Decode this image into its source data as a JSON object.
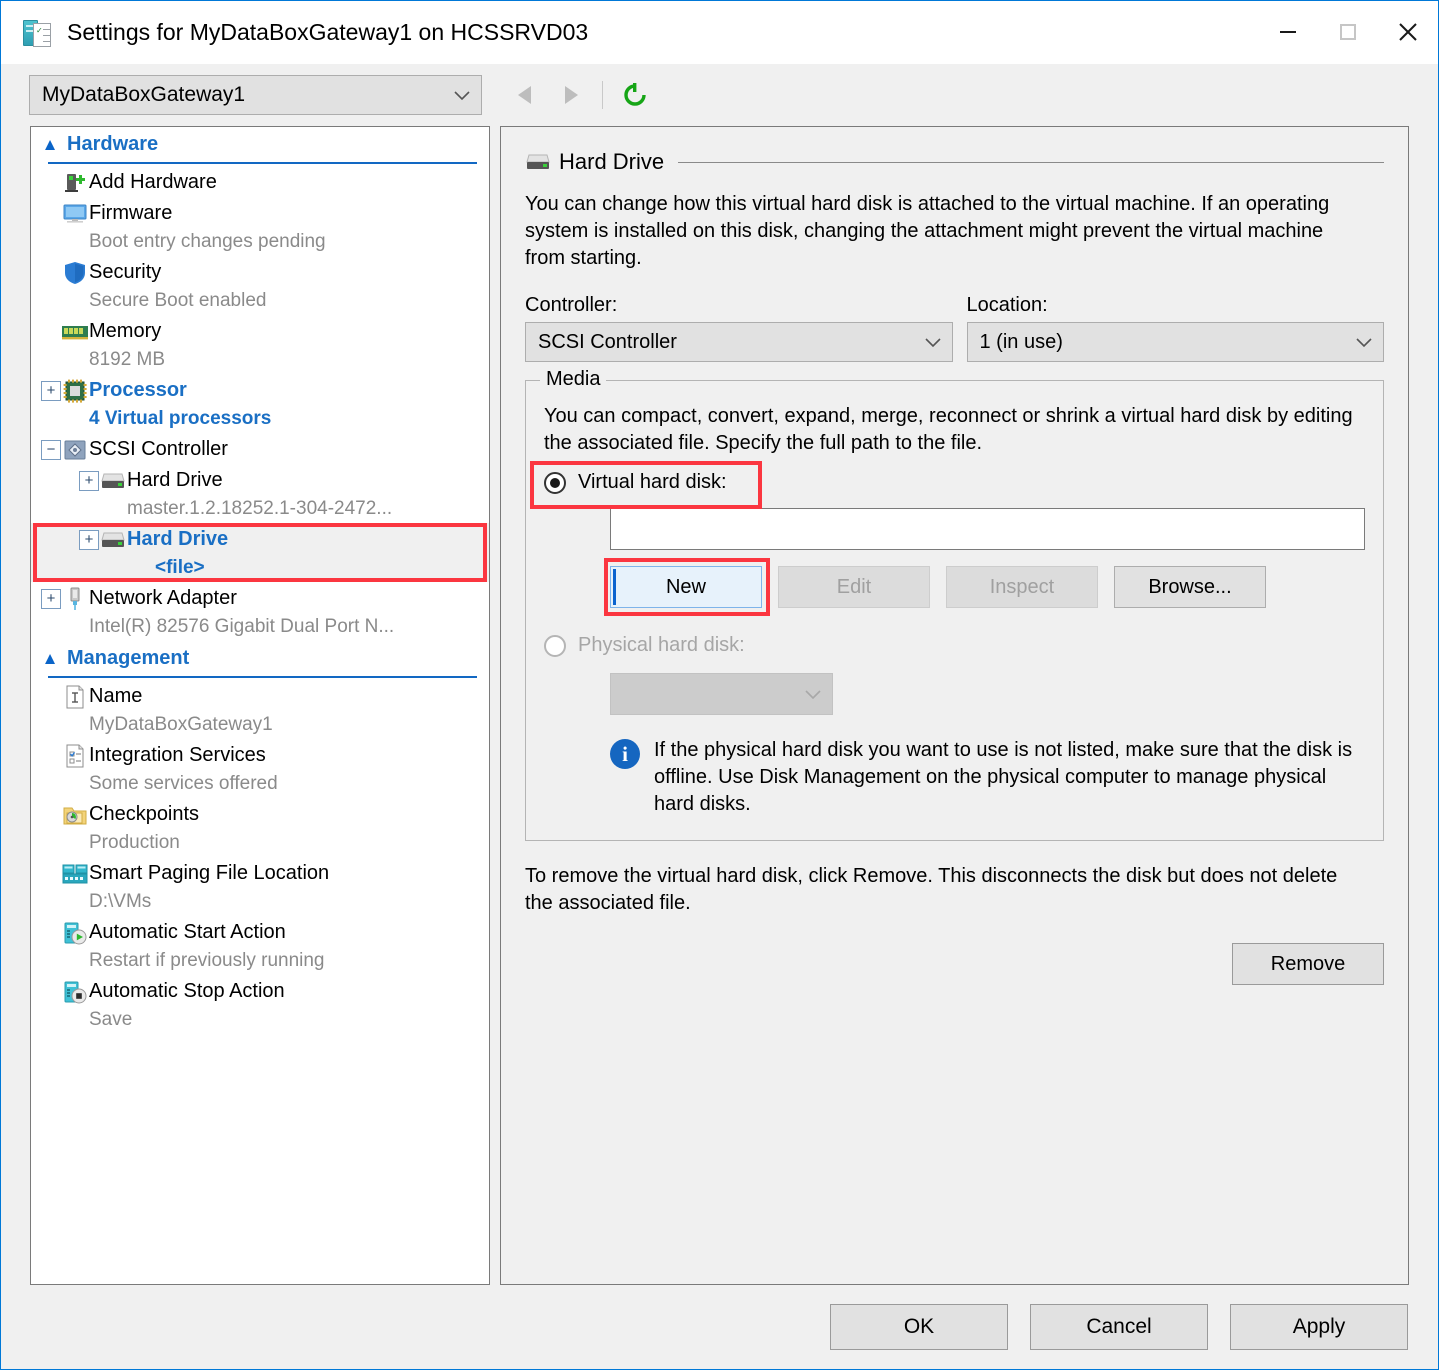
{
  "window": {
    "title": "Settings for MyDataBoxGateway1 on HCSSRVD03",
    "title_icon": "settings-document-icon",
    "minimize_label": "Minimize",
    "maximize_label": "Maximize",
    "close_label": "Close"
  },
  "toolbar": {
    "vm_selector_value": "MyDataBoxGateway1",
    "back_label": "Back",
    "forward_label": "Forward",
    "refresh_label": "Refresh"
  },
  "sidebar": {
    "sections": [
      {
        "id": "hardware",
        "label": "Hardware",
        "items": [
          {
            "icon": "add-hardware-icon",
            "title": "Add Hardware",
            "sub": "",
            "expander": "",
            "highlighted": false,
            "selected": false
          },
          {
            "icon": "firmware-monitor-icon",
            "title": "Firmware",
            "sub": "Boot entry changes pending",
            "expander": "",
            "highlighted": false,
            "selected": false
          },
          {
            "icon": "security-shield-icon",
            "title": "Security",
            "sub": "Secure Boot enabled",
            "expander": "",
            "highlighted": false,
            "selected": false
          },
          {
            "icon": "memory-module-icon",
            "title": "Memory",
            "sub": "8192 MB",
            "expander": "",
            "highlighted": false,
            "selected": false
          },
          {
            "icon": "processor-chip-icon",
            "title": "Processor",
            "sub": "4 Virtual processors",
            "expander": "+",
            "highlighted": false,
            "selected": false,
            "blue": true
          },
          {
            "icon": "scsi-controller-icon",
            "title": "SCSI Controller",
            "sub": "",
            "expander": "−",
            "highlighted": false,
            "selected": false
          },
          {
            "icon": "hard-drive-icon",
            "title": "Hard Drive",
            "sub": "master.1.2.18252.1-304-2472...",
            "expander": "+",
            "indent": true,
            "highlighted": false,
            "selected": false
          },
          {
            "icon": "hard-drive-icon",
            "title": "Hard Drive",
            "sub": "<file>",
            "expander": "+",
            "indent": true,
            "highlighted": true,
            "selected": true,
            "blue": true
          },
          {
            "icon": "network-adapter-icon",
            "title": "Network Adapter",
            "sub": "Intel(R) 82576 Gigabit Dual Port N...",
            "expander": "+",
            "highlighted": false,
            "selected": false
          }
        ]
      },
      {
        "id": "management",
        "label": "Management",
        "items": [
          {
            "icon": "name-text-icon",
            "title": "Name",
            "sub": "MyDataBoxGateway1",
            "expander": "",
            "highlighted": false,
            "selected": false
          },
          {
            "icon": "integration-services-icon",
            "title": "Integration Services",
            "sub": "Some services offered",
            "expander": "",
            "highlighted": false,
            "selected": false
          },
          {
            "icon": "checkpoints-icon",
            "title": "Checkpoints",
            "sub": "Production",
            "expander": "",
            "highlighted": false,
            "selected": false
          },
          {
            "icon": "smart-paging-icon",
            "title": "Smart Paging File Location",
            "sub": "D:\\VMs",
            "expander": "",
            "highlighted": false,
            "selected": false
          },
          {
            "icon": "auto-start-icon",
            "title": "Automatic Start Action",
            "sub": "Restart if previously running",
            "expander": "",
            "highlighted": false,
            "selected": false
          },
          {
            "icon": "auto-stop-icon",
            "title": "Automatic Stop Action",
            "sub": "Save",
            "expander": "",
            "highlighted": false,
            "selected": false
          }
        ]
      }
    ]
  },
  "main": {
    "group_title": "Hard Drive",
    "group_icon": "hard-drive-icon",
    "description": "You can change how this virtual hard disk is attached to the virtual machine. If an operating system is installed on this disk, changing the attachment might prevent the virtual machine from starting.",
    "controller_label": "Controller:",
    "controller_value": "SCSI Controller",
    "location_label": "Location:",
    "location_value": "1 (in use)",
    "media": {
      "group_label": "Media",
      "description": "You can compact, convert, expand, merge, reconnect or shrink a virtual hard disk by editing the associated file. Specify the full path to the file.",
      "virtual_hard_disk_label": "Virtual hard disk:",
      "virtual_hard_disk_selected": true,
      "vhd_path_value": "",
      "vhd_path_placeholder": "",
      "buttons": [
        {
          "label": "New",
          "state": "focused"
        },
        {
          "label": "Edit",
          "state": "disabled"
        },
        {
          "label": "Inspect",
          "state": "disabled"
        },
        {
          "label": "Browse...",
          "state": "enabled"
        }
      ],
      "physical_hard_disk_label": "Physical hard disk:",
      "physical_hard_disk_selected": false,
      "physical_disk_value": "",
      "info_icon": "info-icon",
      "info_text": "If the physical hard disk you want to use is not listed, make sure that the disk is offline. Use Disk Management on the physical computer to manage physical hard disks."
    },
    "remove_description": "To remove the virtual hard disk, click Remove. This disconnects the disk but does not delete the associated file.",
    "remove_button_label": "Remove"
  },
  "footer": {
    "ok_label": "OK",
    "cancel_label": "Cancel",
    "apply_label": "Apply"
  },
  "colors": {
    "accent": "#0078d7",
    "annotation_red": "#fb3640",
    "link_blue": "#1a6fc4",
    "window_bg": "#f0f0f0"
  }
}
